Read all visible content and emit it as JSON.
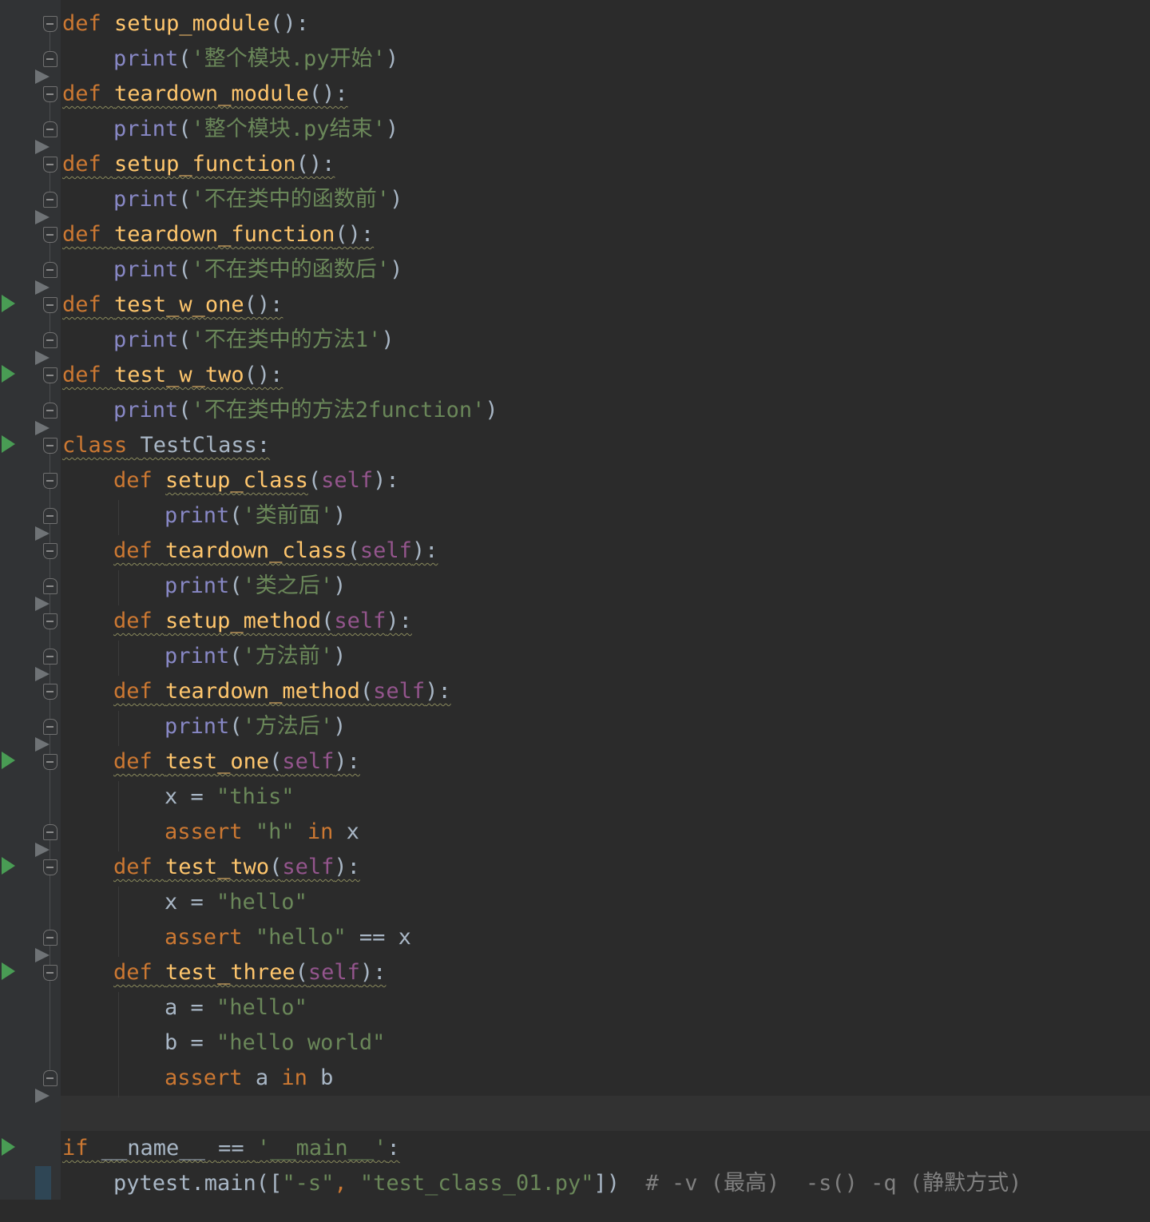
{
  "editor": {
    "language": "python",
    "lines": {
      "l1": [
        "def",
        "setup_module",
        "():"
      ],
      "l2": [
        "print",
        "(",
        "'整个模块.py开始'",
        ")"
      ],
      "l3": [
        "def",
        "teardown_module",
        "():"
      ],
      "l4": [
        "print",
        "(",
        "'整个模块.py结束'",
        ")"
      ],
      "l5": [
        "def",
        "setup_function",
        "():"
      ],
      "l6": [
        "print",
        "(",
        "'不在类中的函数前'",
        ")"
      ],
      "l7": [
        "def",
        "teardown_function",
        "():"
      ],
      "l8": [
        "print",
        "(",
        "'不在类中的函数后'",
        ")"
      ],
      "l9": [
        "def",
        "test_w_one",
        "():"
      ],
      "l10": [
        "print",
        "(",
        "'不在类中的方法1'",
        ")"
      ],
      "l11": [
        "def",
        "test_w_two",
        "():"
      ],
      "l12": [
        "print",
        "(",
        "'不在类中的方法2function'",
        ")"
      ],
      "l13": [
        "class",
        "TestClass:"
      ],
      "l14": [
        "def",
        "setup_class",
        "(",
        "self",
        "):"
      ],
      "l15": [
        "print",
        "(",
        "'类前面'",
        ")"
      ],
      "l16": [
        "def",
        "teardown_class",
        "(",
        "self",
        "):"
      ],
      "l17": [
        "print",
        "(",
        "'类之后'",
        ")"
      ],
      "l18": [
        "def",
        "setup_method",
        "(",
        "self",
        "):"
      ],
      "l19": [
        "print",
        "(",
        "'方法前'",
        ")"
      ],
      "l20": [
        "def",
        "teardown_method",
        "(",
        "self",
        "):"
      ],
      "l21": [
        "print",
        "(",
        "'方法后'",
        ")"
      ],
      "l22": [
        "def",
        "test_one",
        "(",
        "self",
        "):"
      ],
      "l23": [
        "x = ",
        "\"this\""
      ],
      "l24": [
        "assert",
        "\"h\"",
        "in",
        "x"
      ],
      "l25": [
        "def",
        "test_two",
        "(",
        "self",
        "):"
      ],
      "l26": [
        "x = ",
        "\"hello\""
      ],
      "l27": [
        "assert",
        "\"hello\"",
        "== x"
      ],
      "l28": [
        "def",
        "test_three",
        "(",
        "self",
        "):"
      ],
      "l29": [
        "a = ",
        "\"hello\""
      ],
      "l30": [
        "b = ",
        "\"hello world\""
      ],
      "l31": [
        "assert",
        "a",
        "in",
        "b"
      ],
      "l33": [
        "if",
        "__name__",
        "==",
        "'__main__'",
        ":"
      ],
      "l34": [
        "pytest.main([",
        "\"-s\"",
        ", ",
        "\"test_class_01.py\"",
        "])",
        "# -v (最高)  -s() -q (静默方式)"
      ]
    }
  },
  "colors": {
    "background": "#2b2b2b",
    "gutter": "#313335",
    "keyword": "#cc7832",
    "function_name": "#ffc66d",
    "builtin": "#8888c6",
    "string": "#6a8759",
    "self": "#94558d",
    "comment": "#808080",
    "run_icon": "#499c54"
  }
}
